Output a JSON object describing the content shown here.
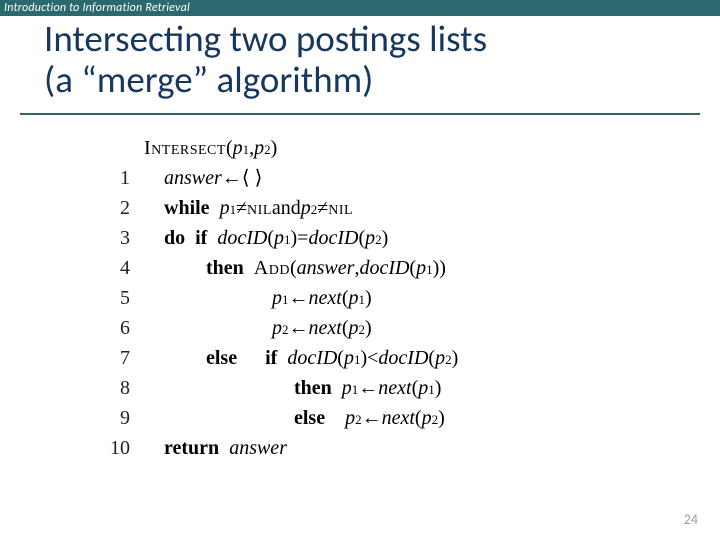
{
  "banner": "Introduction to Information Retrieval",
  "title_line1": "Intersecting two postings lists",
  "title_line2": "(a “merge” algorithm)",
  "page_number": "24",
  "algo": {
    "head": {
      "name": "Intersect",
      "open": "(",
      "p1": "p",
      "s1": "1",
      "comma": ", ",
      "p2": "p",
      "s2": "2",
      "close": ")"
    },
    "l1": {
      "n": "1",
      "answer": "answer",
      "arrow": " ← ",
      "empty": "⟨ ⟩"
    },
    "l2": {
      "n": "2",
      "while": "while",
      "p1": "p",
      "s1": "1",
      "neq1": " ≠ ",
      "nil1": "nil",
      "and": " and ",
      "p2": "p",
      "s2": "2",
      "neq2": " ≠ ",
      "nil2": "nil"
    },
    "l3": {
      "n": "3",
      "do": "do",
      "if": "if",
      "d1a": "docID",
      "op1": "(",
      "p1": "p",
      "s1": "1",
      "cp1": ")",
      "eq": " = ",
      "d1b": "docID",
      "op2": "(",
      "p2": "p",
      "s2": "2",
      "cp2": ")"
    },
    "l4": {
      "n": "4",
      "then": "then",
      "add": "Add",
      "op": "(",
      "answer": "answer",
      "comma": ", ",
      "docid": "docID",
      "op2": "(",
      "p1": "p",
      "s1": "1",
      "cp2": ")",
      "cp": ")"
    },
    "l5": {
      "n": "5",
      "p1": "p",
      "s1": "1",
      "arrow": " ← ",
      "next": "next",
      "op": "(",
      "p1b": "p",
      "s1b": "1",
      "cp": ")"
    },
    "l6": {
      "n": "6",
      "p2": "p",
      "s2": "2",
      "arrow": " ← ",
      "next": "next",
      "op": "(",
      "p2b": "p",
      "s2b": "2",
      "cp": ")"
    },
    "l7": {
      "n": "7",
      "else": "else",
      "if": "if",
      "d1": "docID",
      "op1": "(",
      "p1": "p",
      "s1": "1",
      "cp1": ")",
      "lt": " < ",
      "d2": "docID",
      "op2": "(",
      "p2": "p",
      "s2": "2",
      "cp2": ")"
    },
    "l8": {
      "n": "8",
      "then": "then",
      "p1": "p",
      "s1": "1",
      "arrow": " ← ",
      "next": "next",
      "op": "(",
      "p1b": "p",
      "s1b": "1",
      "cp": ")"
    },
    "l9": {
      "n": "9",
      "else": "else",
      "p2": "p",
      "s2": "2",
      "arrow": " ← ",
      "next": "next",
      "op": "(",
      "p2b": "p",
      "s2b": "2",
      "cp": ")"
    },
    "l10": {
      "n": "10",
      "return": "return",
      "answer": "answer"
    }
  }
}
